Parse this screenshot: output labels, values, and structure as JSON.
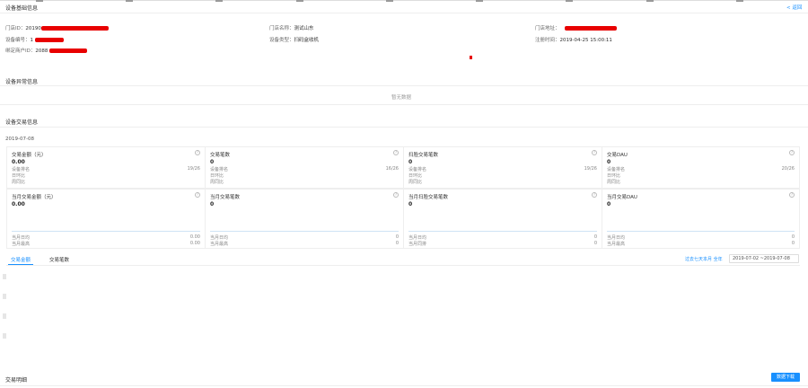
{
  "header": {
    "back_label": "< 返回"
  },
  "basic": {
    "title": "设备基础信息",
    "store_id_label": "门店ID：",
    "store_id_value": "20190",
    "store_name_label": "门店名称：",
    "store_name_value": "测试山东",
    "store_addr_label": "门店地址：",
    "device_no_label": "设备编号：",
    "device_no_value": "1",
    "device_type_label": "设备类型：",
    "device_type_value": "扫码盒收机",
    "reg_time_label": "注册时间：",
    "reg_time_value": "2019-04-25 15:00:11",
    "merchant_id_label": "绑定商户ID：",
    "merchant_id_value": "2088"
  },
  "abnormal": {
    "title": "设备异常信息",
    "empty_text": "暂无数据"
  },
  "trade": {
    "title": "设备交易信息",
    "date": "2019-07-08",
    "cards_row1": [
      {
        "title": "交易金额（元）",
        "value": "0.00",
        "rank_label": "设备排名",
        "rank_value": "19/26",
        "r2": "日环比",
        "r3": "周同比"
      },
      {
        "title": "交易笔数",
        "value": "0",
        "rank_label": "设备排名",
        "rank_value": "16/26",
        "r2": "日环比",
        "r3": "周同比"
      },
      {
        "title": "扫脸交易笔数",
        "value": "0",
        "rank_label": "设备排名",
        "rank_value": "19/26",
        "r2": "日环比",
        "r3": "周同比"
      },
      {
        "title": "交易DAU",
        "value": "0",
        "rank_label": "设备排名",
        "rank_value": "20/26",
        "r2": "日环比",
        "r3": "周同比"
      }
    ],
    "cards_row2": [
      {
        "title": "当月交易金额（元）",
        "value": "0.00",
        "avg_label": "当月日均",
        "avg_value": "0.00",
        "max_label": "当月最高",
        "max_value": "0.00"
      },
      {
        "title": "当月交易笔数",
        "value": "0",
        "avg_label": "当月日均",
        "avg_value": "0",
        "max_label": "当月最高",
        "max_value": "0"
      },
      {
        "title": "当月扫脸交易笔数",
        "value": "0",
        "avg_label": "当月日均",
        "avg_value": "0",
        "max_label": "当月同排",
        "max_value": "0"
      },
      {
        "title": "当月交易DAU",
        "value": "0",
        "avg_label": "当月日均",
        "avg_value": "0",
        "max_label": "当月最高",
        "max_value": "0"
      }
    ],
    "tabs": [
      "交易金额",
      "交易笔数"
    ],
    "ranges": "过去七天本月 全年",
    "date_range": "2019-07-02 ~2019-07-08"
  },
  "detail": {
    "title": "交易明细",
    "download_label": "数据下载"
  }
}
